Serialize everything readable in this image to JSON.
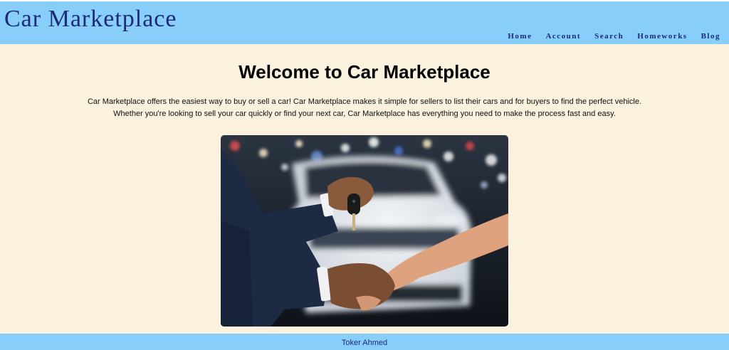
{
  "site": {
    "title": "Car Marketplace"
  },
  "nav": {
    "items": [
      {
        "label": "Home"
      },
      {
        "label": "Account"
      },
      {
        "label": "Search"
      },
      {
        "label": "Homeworks"
      },
      {
        "label": "Blog"
      }
    ]
  },
  "main": {
    "heading": "Welcome to Car Marketplace",
    "intro_line1": "Car Marketplace offers the easiest way to buy or sell a car! Car Marketplace makes it simple for sellers to list their cars and for buyers to find the perfect vehicle.",
    "intro_line2": "Whether you're looking to sell your car quickly or find your next car, Car Marketplace has everything you need to make the process fast and easy."
  },
  "footer": {
    "text": "Toker Ahmed"
  },
  "colors": {
    "header_bg": "#87cefa",
    "title_text": "#1e2a78",
    "page_bg": "#faf1de"
  }
}
